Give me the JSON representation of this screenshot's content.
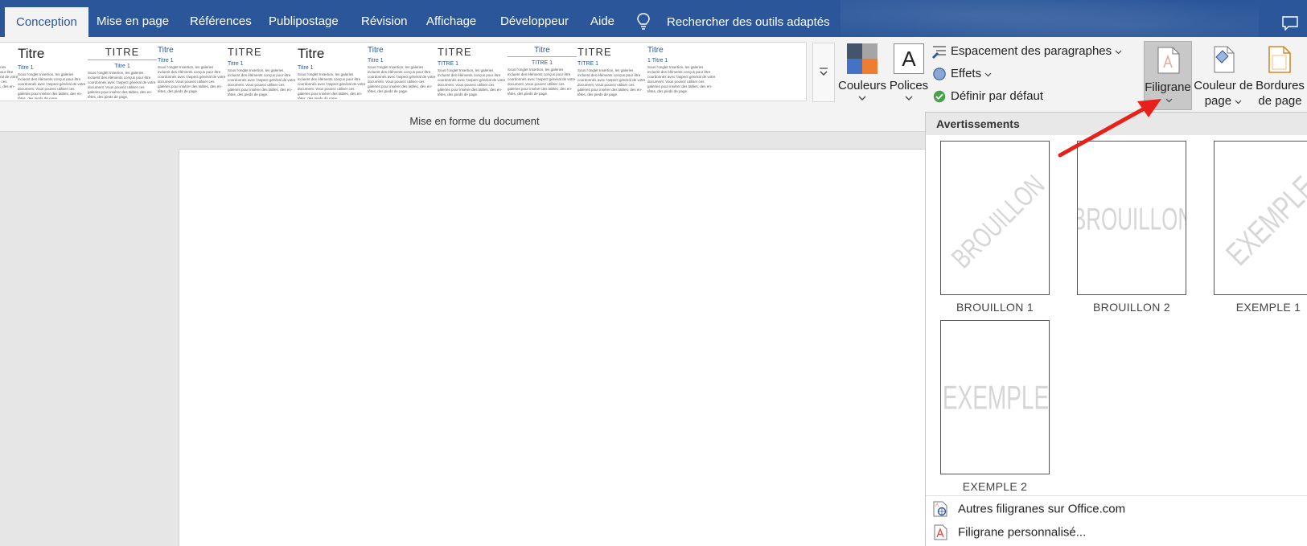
{
  "tabs": {
    "conception": "Conception",
    "mise_en_page": "Mise en page",
    "references": "Références",
    "publipostage": "Publipostage",
    "revision": "Révision",
    "affichage": "Affichage",
    "developpeur": "Développeur",
    "aide": "Aide"
  },
  "search": {
    "label": "Rechercher des outils adaptés"
  },
  "ribbon": {
    "style_gallery": [
      {
        "title": "Titre",
        "heading": "Titre 1"
      },
      {
        "title": "Titre",
        "heading": "Titre 1"
      },
      {
        "title": "TITRE",
        "heading": "Titre 1"
      },
      {
        "title": "Titre",
        "heading": "Titre 1"
      },
      {
        "title": "TITRE",
        "heading": "Titre 1"
      },
      {
        "title": "Titre",
        "heading": "Titre 1"
      },
      {
        "title": "Titre",
        "heading": "Titre 1"
      },
      {
        "title": "TITRE",
        "heading": "TITRE 1"
      },
      {
        "title": "Titre",
        "heading": "TITRE 1"
      },
      {
        "title": "TITRE",
        "heading": "TITRE 1"
      },
      {
        "title": "Titre",
        "heading": "1 Titre 1"
      }
    ],
    "thumb_body_text": "Sous l'onglet Insertion, les galeries incluent des éléments conçus pour être coordonnés avec l'aspect général de votre document. Vous pouvez utiliser ces galeries pour insérer des tables, des en-têtes, des pieds de page.",
    "colors_label": "Couleurs",
    "fonts_label": "Polices",
    "fonts_glyph": "A",
    "paragraph_spacing_label": "Espacement des paragraphes",
    "effects_label": "Effets",
    "set_default_label": "Définir par défaut",
    "watermark_label": "Filigrane",
    "page_color_label_1": "Couleur de",
    "page_color_label_2": "page",
    "page_borders_label_1": "Bordures",
    "page_borders_label_2": "de page",
    "group_label": "Mise en forme du document",
    "theme_colors": [
      "#44546a",
      "#a5a5a5",
      "#4472c4",
      "#ed7d31"
    ],
    "accent_color": "#2b579a"
  },
  "dropdown": {
    "header": "Avertissements",
    "watermarks": [
      {
        "caption": "BROUILLON 1",
        "text": "BROUILLON",
        "orientation": "diagonal"
      },
      {
        "caption": "BROUILLON 2",
        "text": "BROUILLON",
        "orientation": "horizontal"
      },
      {
        "caption": "EXEMPLE 1",
        "text": "EXEMPLE",
        "orientation": "diagonal"
      },
      {
        "caption": "EXEMPLE 2",
        "text": "EXEMPLE",
        "orientation": "horizontal"
      }
    ],
    "more_watermarks_label": "Autres filigranes sur Office.com",
    "custom_watermark_label": "Filigrane personnalisé..."
  }
}
